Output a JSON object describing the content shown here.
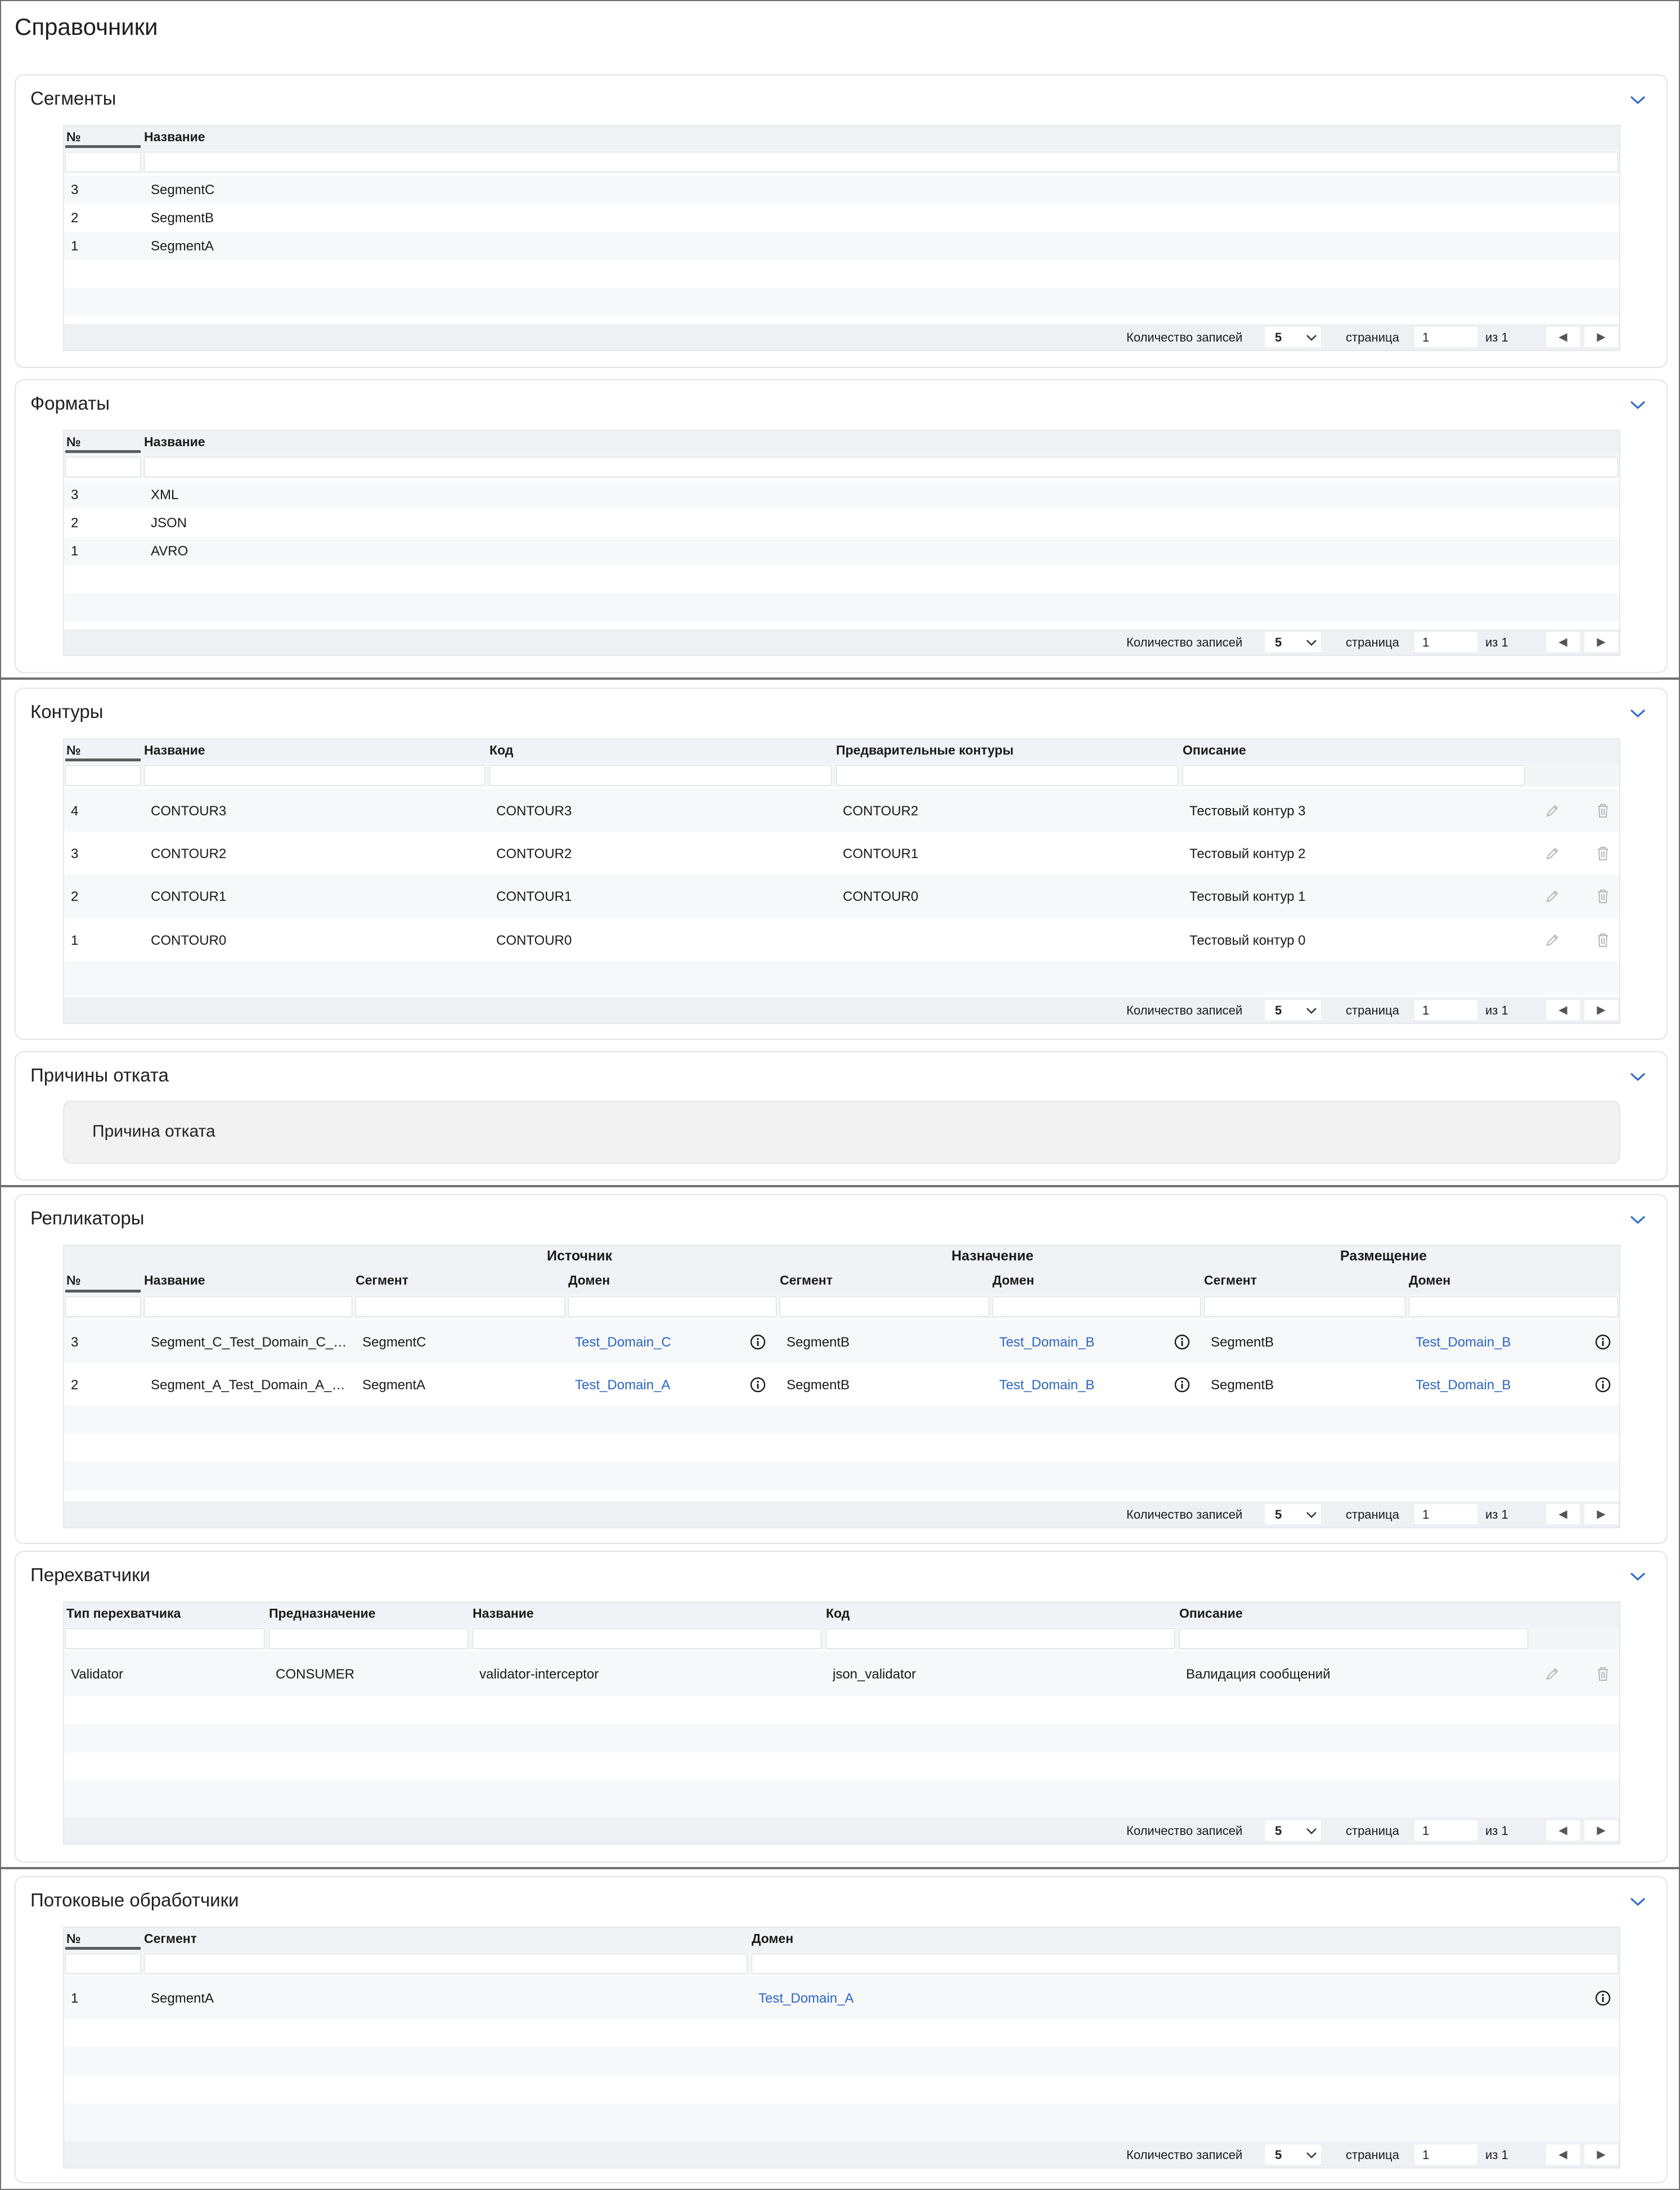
{
  "page_title": "Справочники",
  "footer_labels": {
    "records": "Количество записей",
    "page": "страница",
    "of": "из 1",
    "prev": "◀",
    "next": "▶"
  },
  "segments": {
    "title": "Сегменты",
    "columns": [
      "№",
      "Название"
    ],
    "rows": [
      [
        "3",
        "SegmentC"
      ],
      [
        "2",
        "SegmentB"
      ],
      [
        "1",
        "SegmentA"
      ]
    ],
    "page_size": "5",
    "page": "1"
  },
  "formats": {
    "title": "Форматы",
    "columns": [
      "№",
      "Название"
    ],
    "rows": [
      [
        "3",
        "XML"
      ],
      [
        "2",
        "JSON"
      ],
      [
        "1",
        "AVRO"
      ]
    ],
    "page_size": "5",
    "page": "1"
  },
  "contours": {
    "title": "Контуры",
    "columns": [
      "№",
      "Название",
      "Код",
      "Предварительные контуры",
      "Описание"
    ],
    "rows": [
      [
        "4",
        "CONTOUR3",
        "CONTOUR3",
        "CONTOUR2",
        "Тестовый контур 3"
      ],
      [
        "3",
        "CONTOUR2",
        "CONTOUR2",
        "CONTOUR1",
        "Тестовый контур 2"
      ],
      [
        "2",
        "CONTOUR1",
        "CONTOUR1",
        "CONTOUR0",
        "Тестовый контур 1"
      ],
      [
        "1",
        "CONTOUR0",
        "CONTOUR0",
        "",
        "Тестовый контур 0"
      ]
    ],
    "page_size": "5",
    "page": "1"
  },
  "rollback": {
    "title": "Причины отката",
    "item": "Причина отката"
  },
  "replicators": {
    "title": "Репликаторы",
    "groups": [
      "Источник",
      "Назначение",
      "Размещение"
    ],
    "columns": [
      "№",
      "Название",
      "Сегмент",
      "Домен",
      "Сегмент",
      "Домен",
      "Сегмент",
      "Домен"
    ],
    "rows": [
      [
        "3",
        "Segment_C_Test_Domain_C_Segment_B_Test_Domain_B",
        "SegmentC",
        "Test_Domain_C",
        "SegmentB",
        "Test_Domain_B",
        "SegmentB",
        "Test_Domain_B"
      ],
      [
        "2",
        "Segment_A_Test_Domain_A_Segment_B_Test_Domain_B",
        "SegmentA",
        "Test_Domain_A",
        "SegmentB",
        "Test_Domain_B",
        "SegmentB",
        "Test_Domain_B"
      ]
    ],
    "page_size": "5",
    "page": "1"
  },
  "interceptors": {
    "title": "Перехватчики",
    "columns": [
      "Тип перехватчика",
      "Предназначение",
      "Название",
      "Код",
      "Описание"
    ],
    "rows": [
      [
        "Validator",
        "CONSUMER",
        "validator-interceptor",
        "json_validator",
        "Валидация сообщений"
      ]
    ],
    "page_size": "5",
    "page": "1"
  },
  "stream_handlers": {
    "title": "Потоковые обработчики",
    "columns": [
      "№",
      "Сегмент",
      "Домен"
    ],
    "rows": [
      [
        "1",
        "SegmentA",
        "Test_Domain_A"
      ]
    ],
    "page_size": "5",
    "page": "1"
  },
  "colors": {
    "link": "#2a66c8",
    "header_bg": "#f1f2f5",
    "footer_bg": "#eef0f4",
    "border": "#e4e4e4"
  }
}
